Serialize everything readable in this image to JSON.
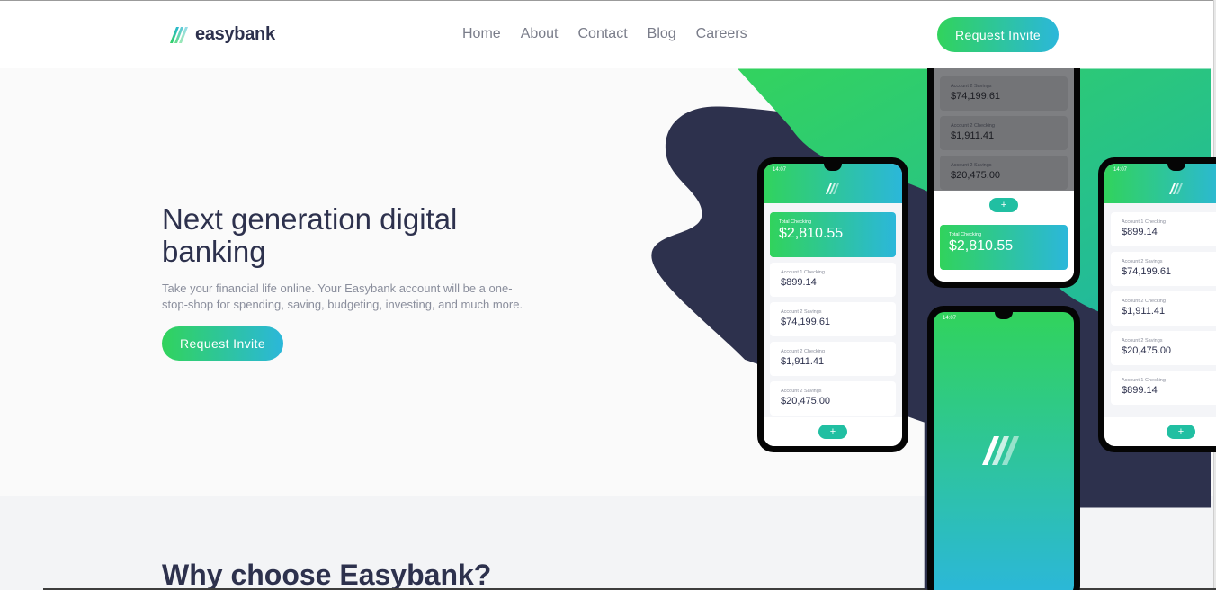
{
  "brand": {
    "name": "easybank"
  },
  "nav": {
    "items": [
      "Home",
      "About",
      "Contact",
      "Blog",
      "Careers"
    ]
  },
  "header": {
    "cta_label": "Request Invite"
  },
  "hero": {
    "title": "Next generation digital banking",
    "description": "Take your financial life online. Your Easybank account will be a one-stop-shop for spending, saving, budgeting, investing, and much more.",
    "cta_label": "Request Invite"
  },
  "section2": {
    "title": "Why choose Easybank?"
  },
  "mockups": {
    "status_time": "14:07",
    "fab_icon": "+",
    "total_label": "Total Checking",
    "total_value": "$2,810.55",
    "accounts": [
      {
        "label": "Account 1 Checking",
        "value": "$899.14"
      },
      {
        "label": "Account 2 Savings",
        "value": "$74,199.61"
      },
      {
        "label": "Account 2 Checking",
        "value": "$1,911.41"
      },
      {
        "label": "Account 2 Savings",
        "value": "$20,475.00"
      },
      {
        "label": "Account 1 Checking",
        "value": "$899.14"
      }
    ]
  },
  "colors": {
    "brand_green": "#31d35c",
    "brand_cyan": "#2bb7da",
    "dark_blue": "#2d314d",
    "grayish_blue": "#9698a6",
    "light_bg": "#fafafa"
  }
}
